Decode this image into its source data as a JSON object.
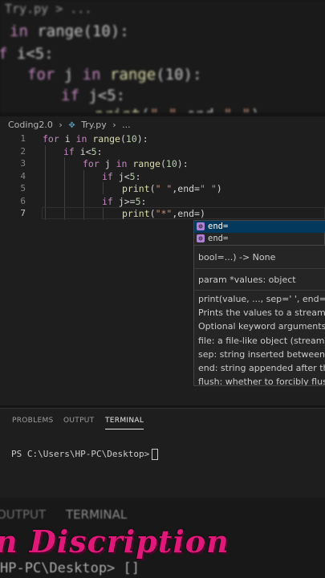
{
  "background_zoom": {
    "crumb": "Try.py > ...",
    "lines": [
      "in range(10):",
      "f i<5:",
      "for j in range(10):",
      "if j<5:",
      "print(\" \",end=\" \")"
    ]
  },
  "editor": {
    "breadcrumb": {
      "folder": "Coding2.0",
      "file": "Try.py",
      "more": "..."
    },
    "line_numbers": [
      "1",
      "2",
      "3",
      "4",
      "5",
      "6",
      "7"
    ],
    "code": {
      "l1_kw": "for",
      "l1_a": " i ",
      "l1_in": "in",
      "l1_fn": " range",
      "l1_b": "(",
      "l1_num": "10",
      "l1_c": "):",
      "l2_kw": "if",
      "l2_a": " i<",
      "l2_num": "5",
      "l2_b": ":",
      "l3_kw": "for",
      "l3_a": " j ",
      "l3_in": "in",
      "l3_fn": " range",
      "l3_b": "(",
      "l3_num": "10",
      "l3_c": "):",
      "l4_kw": "if",
      "l4_a": " j<",
      "l4_num": "5",
      "l4_b": ":",
      "l5_fn": "print",
      "l5_a": "(",
      "l5_s1": "\" \"",
      "l5_b": ",end=",
      "l5_s2": "\" \"",
      "l5_c": ")",
      "l6_kw": "if",
      "l6_a": " j>=",
      "l6_num": "5",
      "l6_b": ":",
      "l7_fn": "print",
      "l7_a": "(",
      "l7_s1": "\"*\"",
      "l7_b": ",end=)"
    }
  },
  "suggest": {
    "items": [
      {
        "icon": "symbol-variable-icon",
        "label": "end=",
        "selected": true
      },
      {
        "icon": "symbol-variable-icon",
        "label": "end=",
        "selected": false
      }
    ]
  },
  "signature_help": {
    "lines": [
      "bool=...) -> None",
      "param *values: object",
      "print(value, ..., sep=' ', end='\\n',",
      "Prints the values to a stream, or",
      "Optional keyword arguments:",
      "file:  a file-like object (stream); c",
      "sep:   string inserted between va",
      "end:   string appended after the",
      "flush: whether to forcibly flush t"
    ]
  },
  "panel": {
    "tabs": [
      "PROBLEMS",
      "OUTPUT",
      "TERMINAL"
    ],
    "active_tab": "TERMINAL",
    "terminal_prompt": "PS C:\\Users\\HP-PC\\Desktop>"
  },
  "bottom_zoom": {
    "tabs": [
      "OUTPUT",
      "TERMINAL"
    ],
    "prompt": "HP-PC\\Desktop> []"
  },
  "caption": "n Discription",
  "colors": {
    "keyword": "#c586c0",
    "function": "#dcdcaa",
    "string": "#ce9178",
    "number": "#b5cea8",
    "caption": "#e0187a"
  }
}
